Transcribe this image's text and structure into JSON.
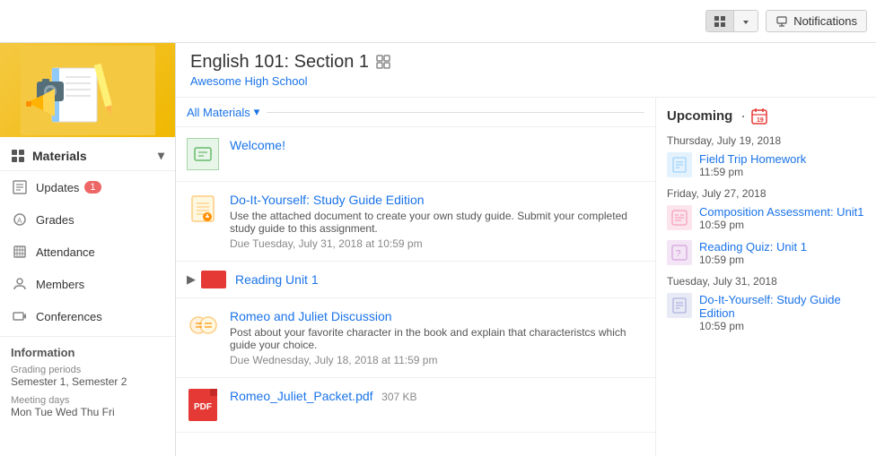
{
  "topbar": {
    "notifications_label": "Notifications",
    "view_toggle": [
      "grid",
      "list"
    ]
  },
  "header": {
    "course_title": "English 101: Section 1",
    "school_name": "Awesome High School"
  },
  "sidebar": {
    "nav_items": [
      {
        "id": "materials",
        "label": "Materials",
        "icon": "grid-icon",
        "active": true,
        "has_dropdown": true
      },
      {
        "id": "updates",
        "label": "Updates",
        "icon": "updates-icon",
        "badge": "1"
      },
      {
        "id": "grades",
        "label": "Grades",
        "icon": "grades-icon"
      },
      {
        "id": "attendance",
        "label": "Attendance",
        "icon": "attendance-icon"
      },
      {
        "id": "members",
        "label": "Members",
        "icon": "members-icon"
      },
      {
        "id": "conferences",
        "label": "Conferences",
        "icon": "conferences-icon"
      }
    ],
    "information": {
      "title": "Information",
      "grading_periods_label": "Grading periods",
      "grading_periods_value": "Semester 1, Semester 2",
      "meeting_days_label": "Meeting days",
      "meeting_days_value": "Mon Tue Wed Thu Fri"
    }
  },
  "materials_toolbar": {
    "all_materials_label": "All Materials"
  },
  "materials": [
    {
      "id": "welcome",
      "type": "announcement",
      "title": "Welcome!",
      "desc": "",
      "due": ""
    },
    {
      "id": "study-guide",
      "type": "assignment",
      "title": "Do-It-Yourself: Study Guide Edition",
      "desc": "Use the attached document to create your own study guide. Submit your completed study guide to this assignment.",
      "due": "Due Tuesday, July 31, 2018 at 10:59 pm"
    },
    {
      "id": "reading-unit",
      "type": "folder",
      "title": "Reading Unit 1",
      "desc": "",
      "due": ""
    },
    {
      "id": "romeo-discussion",
      "type": "discussion",
      "title": "Romeo and Juliet Discussion",
      "desc": "Post about your favorite character in the book and explain that characteristcs which guide your choice.",
      "due": "Due Wednesday, July 18, 2018 at 11:59 pm"
    },
    {
      "id": "romeo-packet",
      "type": "pdf",
      "title": "Romeo_Juliet_Packet.pdf",
      "size": "307 KB",
      "desc": "",
      "due": ""
    }
  ],
  "upcoming": {
    "title": "Upcoming",
    "icon": "calendar-icon",
    "dates": [
      {
        "date": "Thursday, July 19, 2018",
        "items": [
          {
            "title": "Field Trip Homework",
            "time": "11:59 pm",
            "type": "homework"
          }
        ]
      },
      {
        "date": "Friday, July 27, 2018",
        "items": [
          {
            "title": "Composition Assessment: Unit1",
            "time": "10:59 pm",
            "type": "assessment"
          },
          {
            "title": "Reading Quiz: Unit 1",
            "time": "10:59 pm",
            "type": "quiz"
          }
        ]
      },
      {
        "date": "Tuesday, July 31, 2018",
        "items": [
          {
            "title": "Do-It-Yourself: Study Guide Edition",
            "time": "10:59 pm",
            "type": "guide"
          }
        ]
      }
    ]
  }
}
